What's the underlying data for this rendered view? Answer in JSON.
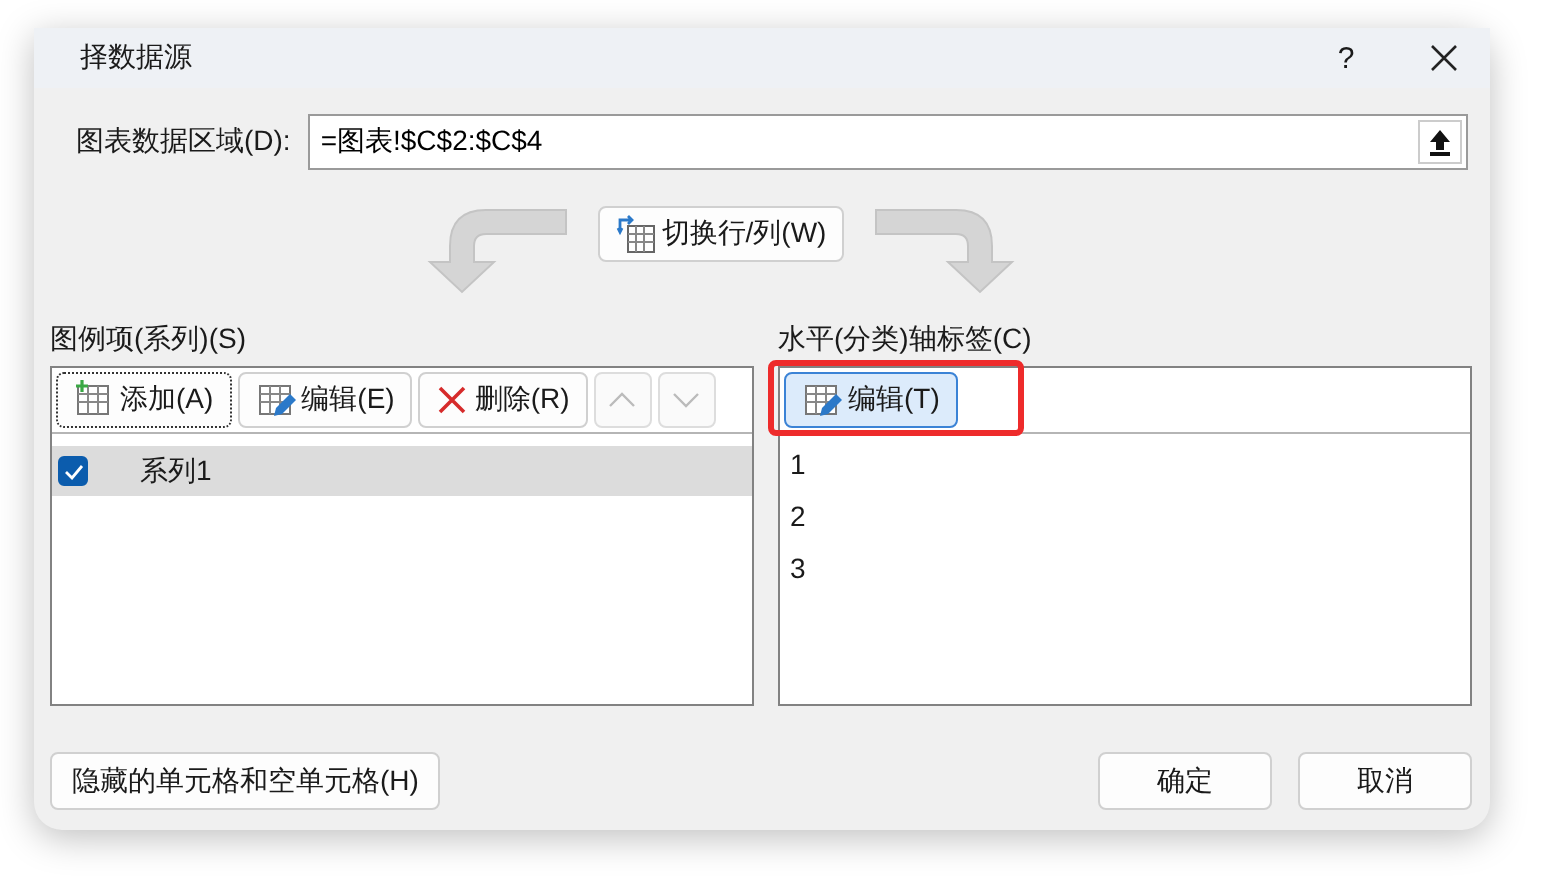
{
  "window": {
    "title": "择数据源",
    "help": "?"
  },
  "data_range": {
    "label": "图表数据区域(D):",
    "value": "=图表!$C$2:$C$4"
  },
  "switch_button": {
    "label": "切换行/列(W)"
  },
  "series_panel": {
    "label": "图例项(系列)(S)",
    "buttons": [
      {
        "kind": "add",
        "label": "添加(A)",
        "focused": true,
        "disabled": false
      },
      {
        "kind": "edit",
        "label": "编辑(E)",
        "focused": false,
        "disabled": false
      },
      {
        "kind": "remove",
        "label": "删除(R)",
        "focused": false,
        "disabled": false
      },
      {
        "kind": "up",
        "focused": false,
        "disabled": true
      },
      {
        "kind": "down",
        "focused": false,
        "disabled": true
      }
    ],
    "items": [
      {
        "label": "系列1",
        "checked": true,
        "selected": true
      }
    ]
  },
  "axis_panel": {
    "label": "水平(分类)轴标签(C)",
    "edit_button": {
      "label": "编辑(T)",
      "highlighted": true
    },
    "items": [
      {
        "label": "1"
      },
      {
        "label": "2"
      },
      {
        "label": "3"
      }
    ]
  },
  "footer": {
    "hidden_cells_button": "隐藏的单元格和空单元格(H)",
    "ok": "确定",
    "cancel": "取消"
  }
}
